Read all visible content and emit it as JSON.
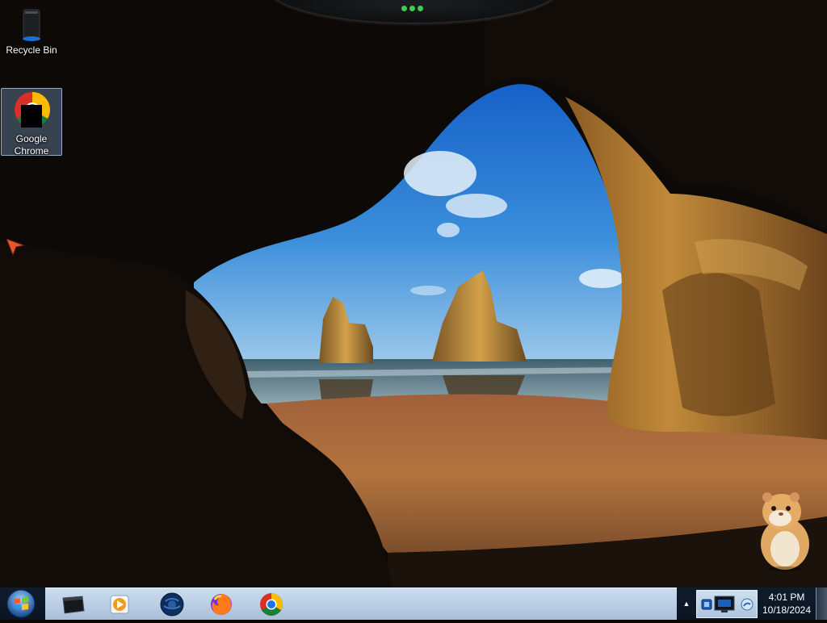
{
  "desktop": {
    "icons": [
      {
        "label": "Recycle Bin",
        "icon": "recycle-bin-icon"
      },
      {
        "label": "Google Chrome",
        "icon": "chrome-icon",
        "selected": true
      }
    ]
  },
  "taskbar": {
    "start": {
      "icon": "windows-start-orb-icon"
    },
    "pinned": [
      {
        "icon": "dark-window-app-icon"
      },
      {
        "icon": "media-player-icon"
      },
      {
        "icon": "globe-browser-icon"
      },
      {
        "icon": "firefox-icon"
      },
      {
        "icon": "chrome-icon"
      }
    ],
    "tray": {
      "show_hidden": "▲",
      "icons": [
        "usb-device-icon",
        "display-monitor-icon",
        "network-icon"
      ]
    },
    "clock": {
      "time": "4:01 PM",
      "date": "10/18/2024"
    }
  },
  "colors": {
    "taskbar_band": "#b9cde3",
    "notch_dots": "#3bd04b",
    "sky": "#2f7fd8"
  }
}
